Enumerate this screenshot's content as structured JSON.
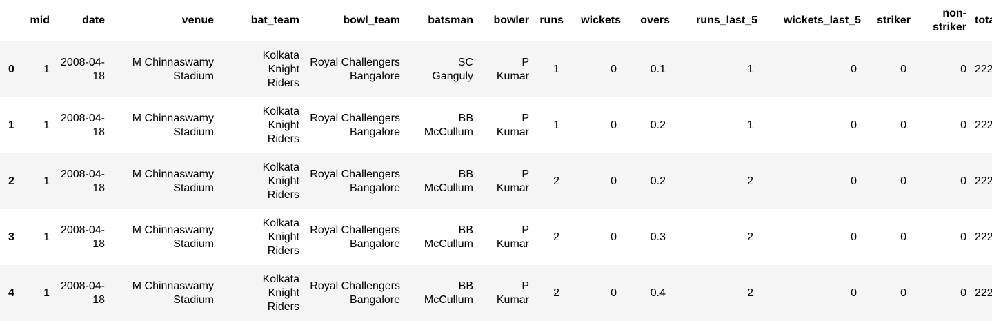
{
  "columns": [
    "",
    "mid",
    "date",
    "venue",
    "bat_team",
    "bowl_team",
    "batsman",
    "bowler",
    "runs",
    "wickets",
    "overs",
    "runs_last_5",
    "wickets_last_5",
    "striker",
    "non-striker",
    "total"
  ],
  "rows": [
    {
      "index": "0",
      "cells": [
        "1",
        "2008-04-18",
        "M Chinnaswamy Stadium",
        "Kolkata Knight Riders",
        "Royal Challengers Bangalore",
        "SC Ganguly",
        "P Kumar",
        "1",
        "0",
        "0.1",
        "1",
        "0",
        "0",
        "0",
        "222"
      ]
    },
    {
      "index": "1",
      "cells": [
        "1",
        "2008-04-18",
        "M Chinnaswamy Stadium",
        "Kolkata Knight Riders",
        "Royal Challengers Bangalore",
        "BB McCullum",
        "P Kumar",
        "1",
        "0",
        "0.2",
        "1",
        "0",
        "0",
        "0",
        "222"
      ]
    },
    {
      "index": "2",
      "cells": [
        "1",
        "2008-04-18",
        "M Chinnaswamy Stadium",
        "Kolkata Knight Riders",
        "Royal Challengers Bangalore",
        "BB McCullum",
        "P Kumar",
        "2",
        "0",
        "0.2",
        "2",
        "0",
        "0",
        "0",
        "222"
      ]
    },
    {
      "index": "3",
      "cells": [
        "1",
        "2008-04-18",
        "M Chinnaswamy Stadium",
        "Kolkata Knight Riders",
        "Royal Challengers Bangalore",
        "BB McCullum",
        "P Kumar",
        "2",
        "0",
        "0.3",
        "2",
        "0",
        "0",
        "0",
        "222"
      ]
    },
    {
      "index": "4",
      "cells": [
        "1",
        "2008-04-18",
        "M Chinnaswamy Stadium",
        "Kolkata Knight Riders",
        "Royal Challengers Bangalore",
        "BB McCullum",
        "P Kumar",
        "2",
        "0",
        "0.4",
        "2",
        "0",
        "0",
        "0",
        "222"
      ]
    }
  ]
}
